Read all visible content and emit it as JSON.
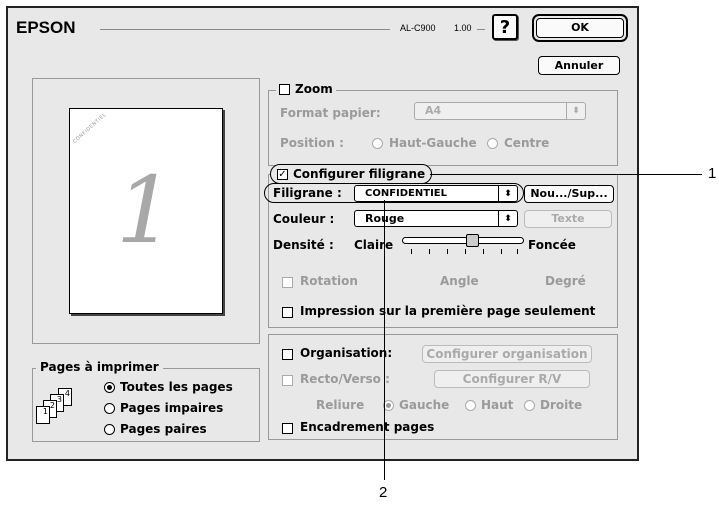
{
  "brand": "EPSON",
  "model": "AL-C900",
  "version": "1.00",
  "help_label": "?",
  "ok_label": "OK",
  "cancel_label": "Annuler",
  "preview": {
    "page_number": "1",
    "watermark_text": "CONFIDENTIEL"
  },
  "zoom": {
    "label": "Zoom",
    "checked": false,
    "paper_format_label": "Format papier:",
    "paper_format_value": "A4",
    "position_label": "Position :",
    "position_options": [
      "Haut-Gauche",
      "Centre"
    ]
  },
  "watermark": {
    "config_label": "Configurer filigrane",
    "config_checked": true,
    "filigrane_label": "Filigrane :",
    "filigrane_value": "CONFIDENTIEL",
    "new_del_label": "Nou.../Sup...",
    "color_label": "Couleur :",
    "color_value": "Rouge",
    "text_button": "Texte",
    "density_label": "Densité :",
    "density_min": "Claire",
    "density_max": "Foncée",
    "density_level": 0.5,
    "rotation_label": "Rotation",
    "angle_label": "Angle",
    "degree_label": "Degré",
    "first_page_only_label": "Impression sur la première page seulement"
  },
  "layout": {
    "organisation_label": "Organisation:",
    "configure_org_button": "Configurer organisation",
    "duplex_label": "Recto/Verso :",
    "configure_duplex_button": "Configurer R/V",
    "binding_label": "Reliure",
    "binding_options": [
      "Gauche",
      "Haut",
      "Droite"
    ],
    "frame_label": "Encadrement pages"
  },
  "pages": {
    "group_label": "Pages à imprimer",
    "options": [
      "Toutes les pages",
      "Pages impaires",
      "Pages paires"
    ],
    "selected": "Toutes les pages",
    "stack_numbers": [
      "1",
      "2",
      "3",
      "4"
    ]
  },
  "callouts": [
    "1",
    "2"
  ]
}
